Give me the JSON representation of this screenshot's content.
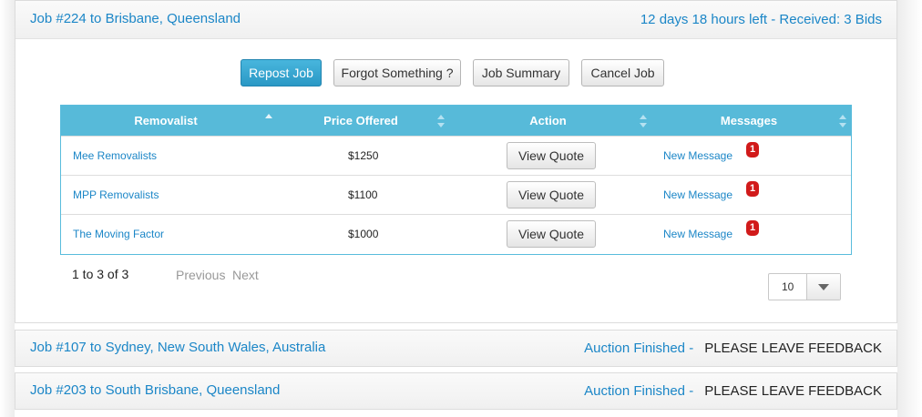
{
  "jobs": [
    {
      "title": "Job #224 to Brisbane, Queensland",
      "status": "12 days 18 hours left - Received: 3 Bids",
      "buttons": {
        "repost": "Repost Job",
        "forgot": "Forgot Something ?",
        "summary": "Job Summary",
        "cancel": "Cancel Job"
      },
      "table": {
        "columns": [
          "Removalist",
          "Price Offered",
          "Action",
          "Messages"
        ],
        "rows": [
          {
            "removalist": "Mee Removalists",
            "price": "$1250",
            "action": "View Quote",
            "message": "New Message",
            "count": "1"
          },
          {
            "removalist": "MPP Removalists",
            "price": "$1100",
            "action": "View Quote",
            "message": "New Message",
            "count": "1"
          },
          {
            "removalist": "The Moving Factor",
            "price": "$1000",
            "action": "View Quote",
            "message": "New Message",
            "count": "1"
          }
        ]
      },
      "pager": {
        "info": "1 to 3 of 3",
        "prev": "Previous",
        "next": "Next",
        "page_size": "10"
      }
    },
    {
      "title": "Job #107 to Sydney, New South Wales, Australia",
      "status": "Auction Finished -",
      "feedback": "PLEASE LEAVE FEEDBACK"
    },
    {
      "title": "Job #203 to South Brisbane, Queensland",
      "status": "Auction Finished -",
      "feedback": "PLEASE LEAVE FEEDBACK"
    }
  ],
  "colors": {
    "accent": "#1b86c7",
    "grid_header": "#57bad9",
    "primary_button": "#2a98c5",
    "badge": "#d11a1a"
  },
  "icons": [
    "sort-asc-icon",
    "sort-both-icon",
    "dropdown-arrow-icon"
  ]
}
